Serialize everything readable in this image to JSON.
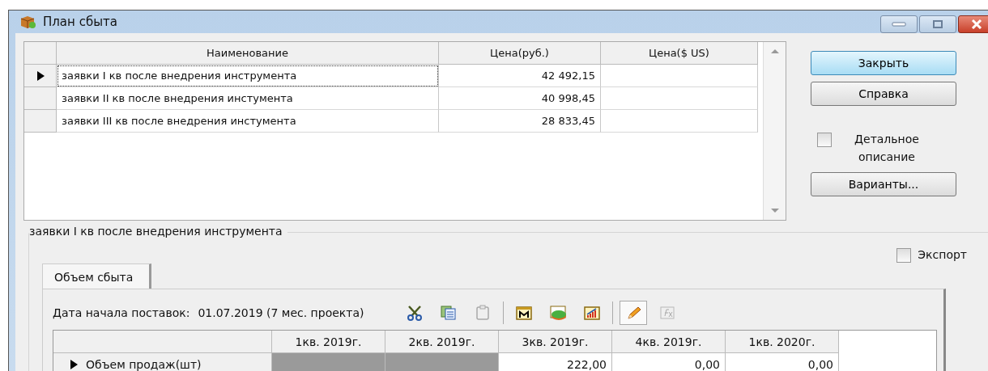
{
  "window": {
    "title": "План сбыта"
  },
  "products": {
    "columns": [
      "Наименование",
      "Цена(руб.)",
      "Цена($ US)"
    ],
    "rows": [
      {
        "name": "заявки I кв после внедрения инструмента",
        "price_rub": "42 492,15",
        "selected": true
      },
      {
        "name": "заявки  II кв после внедрения инстумента",
        "price_rub": "40 998,45",
        "selected": false
      },
      {
        "name": "заявки III кв после внедрения инстумента",
        "price_rub": "28 833,45",
        "selected": false
      }
    ]
  },
  "buttons": [
    {
      "label": "Закрыть",
      "default": true
    },
    {
      "label": "Справка",
      "default": false
    }
  ],
  "detail_checkbox": {
    "label": "Детальное описание",
    "checked": false
  },
  "variants_button": {
    "label": "Варианты..."
  },
  "group": {
    "title": "заявки I кв после внедрения инструмента"
  },
  "export_checkbox": {
    "label": "Экспорт",
    "checked": false
  },
  "tabs": [
    {
      "label": "Объем сбыта",
      "selected": true
    }
  ],
  "start_date": {
    "label": "Дата начала поставок:",
    "value": "01.07.2019 (7 мес. проекта)"
  },
  "toolbar": [
    {
      "kind": "cut",
      "disabled": false,
      "pressed": false
    },
    {
      "kind": "copy",
      "disabled": false,
      "pressed": false
    },
    {
      "kind": "paste",
      "disabled": true,
      "pressed": false
    },
    {
      "kind": "separator"
    },
    {
      "kind": "calendar",
      "disabled": false,
      "pressed": false
    },
    {
      "kind": "pie",
      "disabled": false,
      "pressed": false
    },
    {
      "kind": "bars",
      "disabled": false,
      "pressed": false
    },
    {
      "kind": "separator"
    },
    {
      "kind": "pencil",
      "disabled": false,
      "pressed": true
    },
    {
      "kind": "formula",
      "disabled": true,
      "pressed": false
    }
  ],
  "sales": {
    "columns": [
      "1кв. 2019г.",
      "2кв. 2019г.",
      "3кв. 2019г.",
      "4кв. 2019г.",
      "1кв. 2020г."
    ],
    "rows": [
      {
        "name": "Объем продаж(шт)",
        "selected": true,
        "cells": [
          {
            "disabled": true
          },
          {
            "disabled": true
          },
          {
            "value": "222,00",
            "disabled": false
          },
          {
            "value": "0,00",
            "disabled": false
          },
          {
            "value": "0,00",
            "disabled": false
          }
        ]
      }
    ]
  }
}
